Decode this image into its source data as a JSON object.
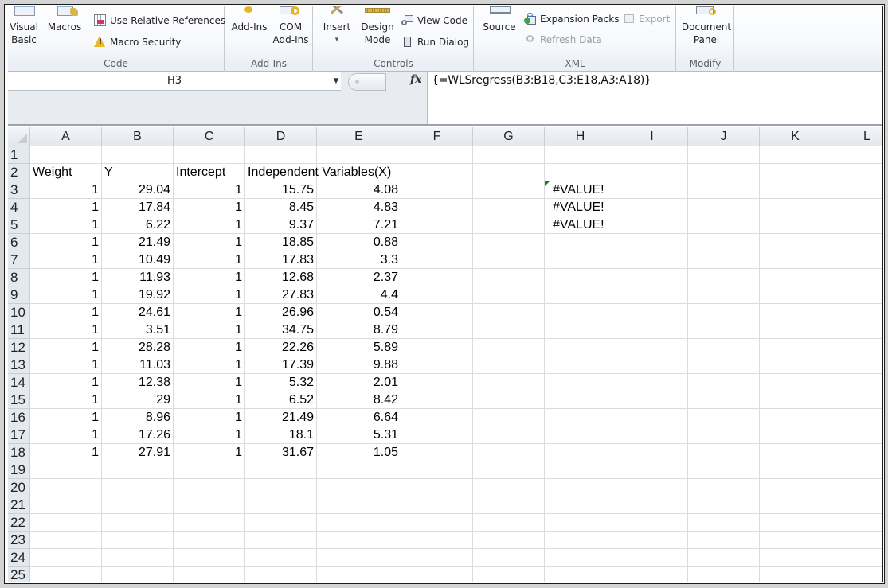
{
  "ribbon": {
    "groups": [
      {
        "name": "code",
        "label": "Code",
        "buttons": [
          {
            "label": "Visual\nBasic",
            "line1": "Visual",
            "line2": "Basic",
            "icon": "visual-basic-icon"
          },
          {
            "label": "Macros",
            "line1": "Macros",
            "line2": "",
            "icon": "macros-icon"
          },
          {
            "label": "Use Relative References",
            "icon": "relative-references-icon"
          },
          {
            "label": "Macro Security",
            "icon": "warning-icon"
          }
        ]
      },
      {
        "name": "add-ins",
        "label": "Add-Ins",
        "buttons": [
          {
            "label": "Add-Ins",
            "line1": "Add-Ins",
            "line2": "",
            "icon": "add-ins-icon"
          },
          {
            "label": "COM Add-Ins",
            "line1": "COM",
            "line2": "Add-Ins",
            "icon": "com-add-ins-icon"
          }
        ]
      },
      {
        "name": "controls",
        "label": "Controls",
        "buttons": [
          {
            "label": "Insert",
            "line1": "Insert",
            "line2": "▾",
            "icon": "insert-controls-icon"
          },
          {
            "label": "Design Mode",
            "line1": "Design",
            "line2": "Mode",
            "icon": "design-mode-icon"
          },
          {
            "label": "View Code",
            "icon": "view-code-icon"
          },
          {
            "label": "Run Dialog",
            "icon": "run-dialog-icon"
          }
        ]
      },
      {
        "name": "xml",
        "label": "XML",
        "buttons": [
          {
            "label": "Source",
            "line1": "Source",
            "line2": "",
            "icon": "xml-source-icon"
          },
          {
            "label": "Expansion Packs",
            "icon": "expansion-packs-icon"
          },
          {
            "label": "Export",
            "icon": "export-icon",
            "disabled": true
          },
          {
            "label": "Refresh Data",
            "icon": "refresh-data-icon",
            "disabled": true
          }
        ]
      },
      {
        "name": "modify",
        "label": "Modify",
        "buttons": [
          {
            "label": "Document Panel",
            "line1": "Document",
            "line2": "Panel",
            "icon": "document-panel-icon"
          }
        ]
      }
    ]
  },
  "formula_bar": {
    "name_box": "H3",
    "fx_label": "fx",
    "formula": "{=WLSregress(B3:B18,C3:E18,A3:A18)}"
  },
  "sheet": {
    "columns": [
      "A",
      "B",
      "C",
      "D",
      "E",
      "F",
      "G",
      "H",
      "I",
      "J",
      "K",
      "L"
    ],
    "row_numbers": [
      "1",
      "2",
      "3",
      "4",
      "5",
      "6",
      "7",
      "8",
      "9",
      "10",
      "11",
      "12",
      "13",
      "14",
      "15",
      "16",
      "17",
      "18",
      "19",
      "20",
      "21",
      "22",
      "23",
      "24",
      "25"
    ],
    "headers": {
      "A2": "Weight",
      "B2": "Y",
      "C2": "Intercept",
      "D2": "Independent Variables(X)"
    },
    "data_rows": [
      {
        "row": 3,
        "weight": "1",
        "y": "29.04",
        "intercept": "1",
        "x1": "15.75",
        "x2": "4.08"
      },
      {
        "row": 4,
        "weight": "1",
        "y": "17.84",
        "intercept": "1",
        "x1": "8.45",
        "x2": "4.83"
      },
      {
        "row": 5,
        "weight": "1",
        "y": "6.22",
        "intercept": "1",
        "x1": "9.37",
        "x2": "7.21"
      },
      {
        "row": 6,
        "weight": "1",
        "y": "21.49",
        "intercept": "1",
        "x1": "18.85",
        "x2": "0.88"
      },
      {
        "row": 7,
        "weight": "1",
        "y": "10.49",
        "intercept": "1",
        "x1": "17.83",
        "x2": "3.3"
      },
      {
        "row": 8,
        "weight": "1",
        "y": "11.93",
        "intercept": "1",
        "x1": "12.68",
        "x2": "2.37"
      },
      {
        "row": 9,
        "weight": "1",
        "y": "19.92",
        "intercept": "1",
        "x1": "27.83",
        "x2": "4.4"
      },
      {
        "row": 10,
        "weight": "1",
        "y": "24.61",
        "intercept": "1",
        "x1": "26.96",
        "x2": "0.54"
      },
      {
        "row": 11,
        "weight": "1",
        "y": "3.51",
        "intercept": "1",
        "x1": "34.75",
        "x2": "8.79"
      },
      {
        "row": 12,
        "weight": "1",
        "y": "28.28",
        "intercept": "1",
        "x1": "22.26",
        "x2": "5.89"
      },
      {
        "row": 13,
        "weight": "1",
        "y": "11.03",
        "intercept": "1",
        "x1": "17.39",
        "x2": "9.88"
      },
      {
        "row": 14,
        "weight": "1",
        "y": "12.38",
        "intercept": "1",
        "x1": "5.32",
        "x2": "2.01"
      },
      {
        "row": 15,
        "weight": "1",
        "y": "29",
        "intercept": "1",
        "x1": "6.52",
        "x2": "8.42"
      },
      {
        "row": 16,
        "weight": "1",
        "y": "8.96",
        "intercept": "1",
        "x1": "21.49",
        "x2": "6.64"
      },
      {
        "row": 17,
        "weight": "1",
        "y": "17.26",
        "intercept": "1",
        "x1": "18.1",
        "x2": "5.31"
      },
      {
        "row": 18,
        "weight": "1",
        "y": "27.91",
        "intercept": "1",
        "x1": "31.67",
        "x2": "1.05"
      }
    ],
    "results": {
      "H3": "#VALUE!",
      "H4": "#VALUE!",
      "H5": "#VALUE!"
    },
    "active_cell": "H3"
  }
}
